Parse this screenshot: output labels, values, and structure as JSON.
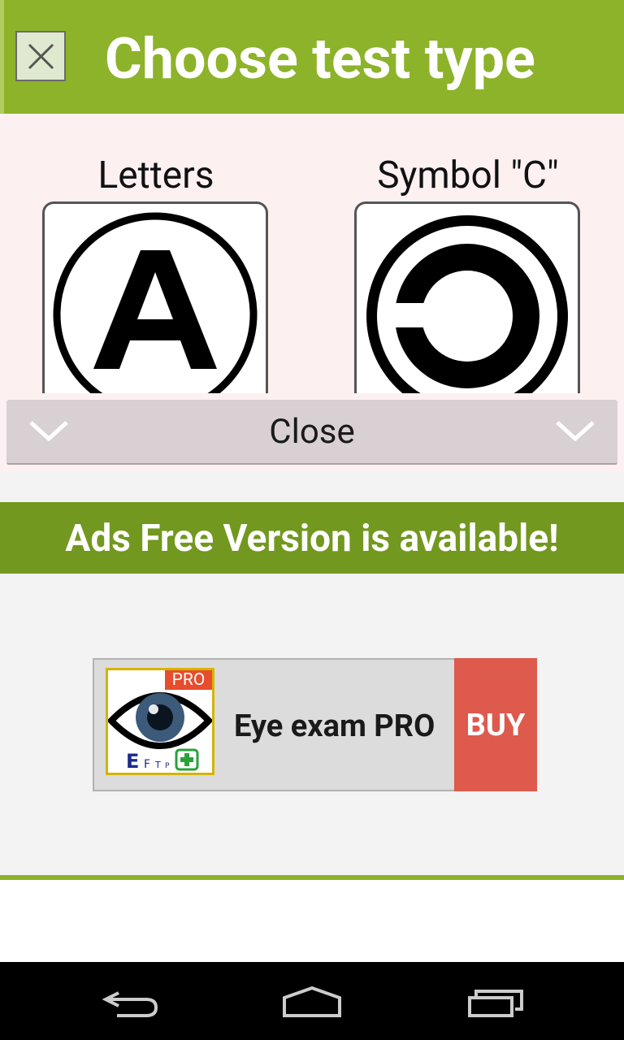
{
  "header": {
    "title": "Choose test type",
    "close_icon": "close-x-icon",
    "color": "#8db32a"
  },
  "options": [
    {
      "label": "Letters",
      "icon": "letter-a-icon"
    },
    {
      "label": "Symbol \"C\"",
      "icon": "landolt-c-icon"
    }
  ],
  "close_bar": {
    "label": "Close",
    "icons": [
      "chevron-down-icon",
      "chevron-down-icon"
    ]
  },
  "ads": {
    "banner_text": "Ads Free Version is available!",
    "app_name": "Eye exam PRO",
    "pro_badge": "PRO",
    "buy_label": "BUY",
    "icon_letters": "E F T P",
    "banner_color": "#72981f",
    "buy_color": "#dd5a4d"
  },
  "navbar": {
    "buttons": [
      "back-icon",
      "home-icon",
      "recent-apps-icon"
    ]
  }
}
